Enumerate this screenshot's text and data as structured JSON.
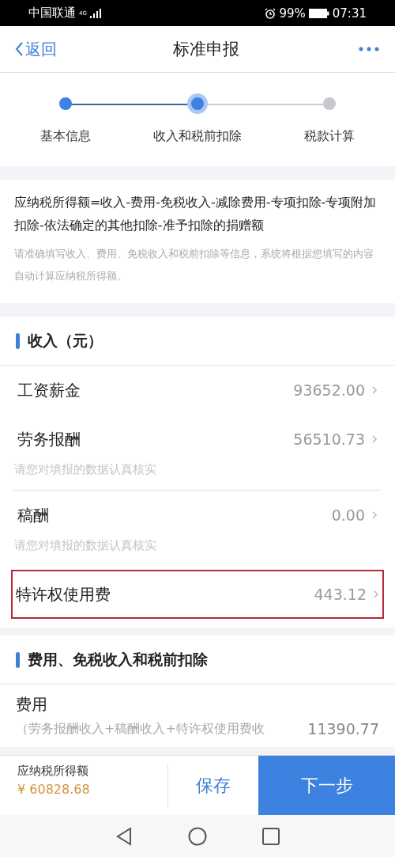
{
  "status_bar": {
    "carrier": "中国联通",
    "network": "4G",
    "battery": "99%",
    "time": "07:31"
  },
  "nav": {
    "back": "返回",
    "title": "标准申报"
  },
  "steps": [
    {
      "label": "基本信息",
      "completed": true,
      "selected": false
    },
    {
      "label": "收入和税前扣除",
      "completed": false,
      "selected": true
    },
    {
      "label": "税款计算",
      "completed": false,
      "selected": false
    }
  ],
  "formula": {
    "text": "应纳税所得额=收入-费用-免税收入-减除费用-专项扣除-专项附加扣除-依法确定的其他扣除-准予扣除的捐赠额",
    "note": "请准确填写收入、费用、免税收入和税前扣除等信息，系统将根据您填写的内容自动计算应纳税所得额。"
  },
  "income": {
    "title": "收入（元）",
    "rows": [
      {
        "label": "工资薪金",
        "value": "93652.00",
        "highlighted": false
      },
      {
        "label": "劳务报酬",
        "value": "56510.73",
        "hint": "请您对填报的数据认真核实",
        "highlighted": false
      },
      {
        "label": "稿酬",
        "value": "0.00",
        "hint": "请您对填报的数据认真核实",
        "highlighted": false
      },
      {
        "label": "特许权使用费",
        "value": "443.12",
        "highlighted": true
      }
    ]
  },
  "deductions": {
    "title": "费用、免税收入和税前扣除",
    "rows": [
      {
        "label": "费用",
        "detail": "（劳务报酬收入+稿酬收入+特许权使用费收",
        "value": "11390.77"
      }
    ]
  },
  "bottom_bar": {
    "label": "应纳税所得额",
    "amount": "¥ 60828.68",
    "save": "保存",
    "next": "下一步"
  }
}
